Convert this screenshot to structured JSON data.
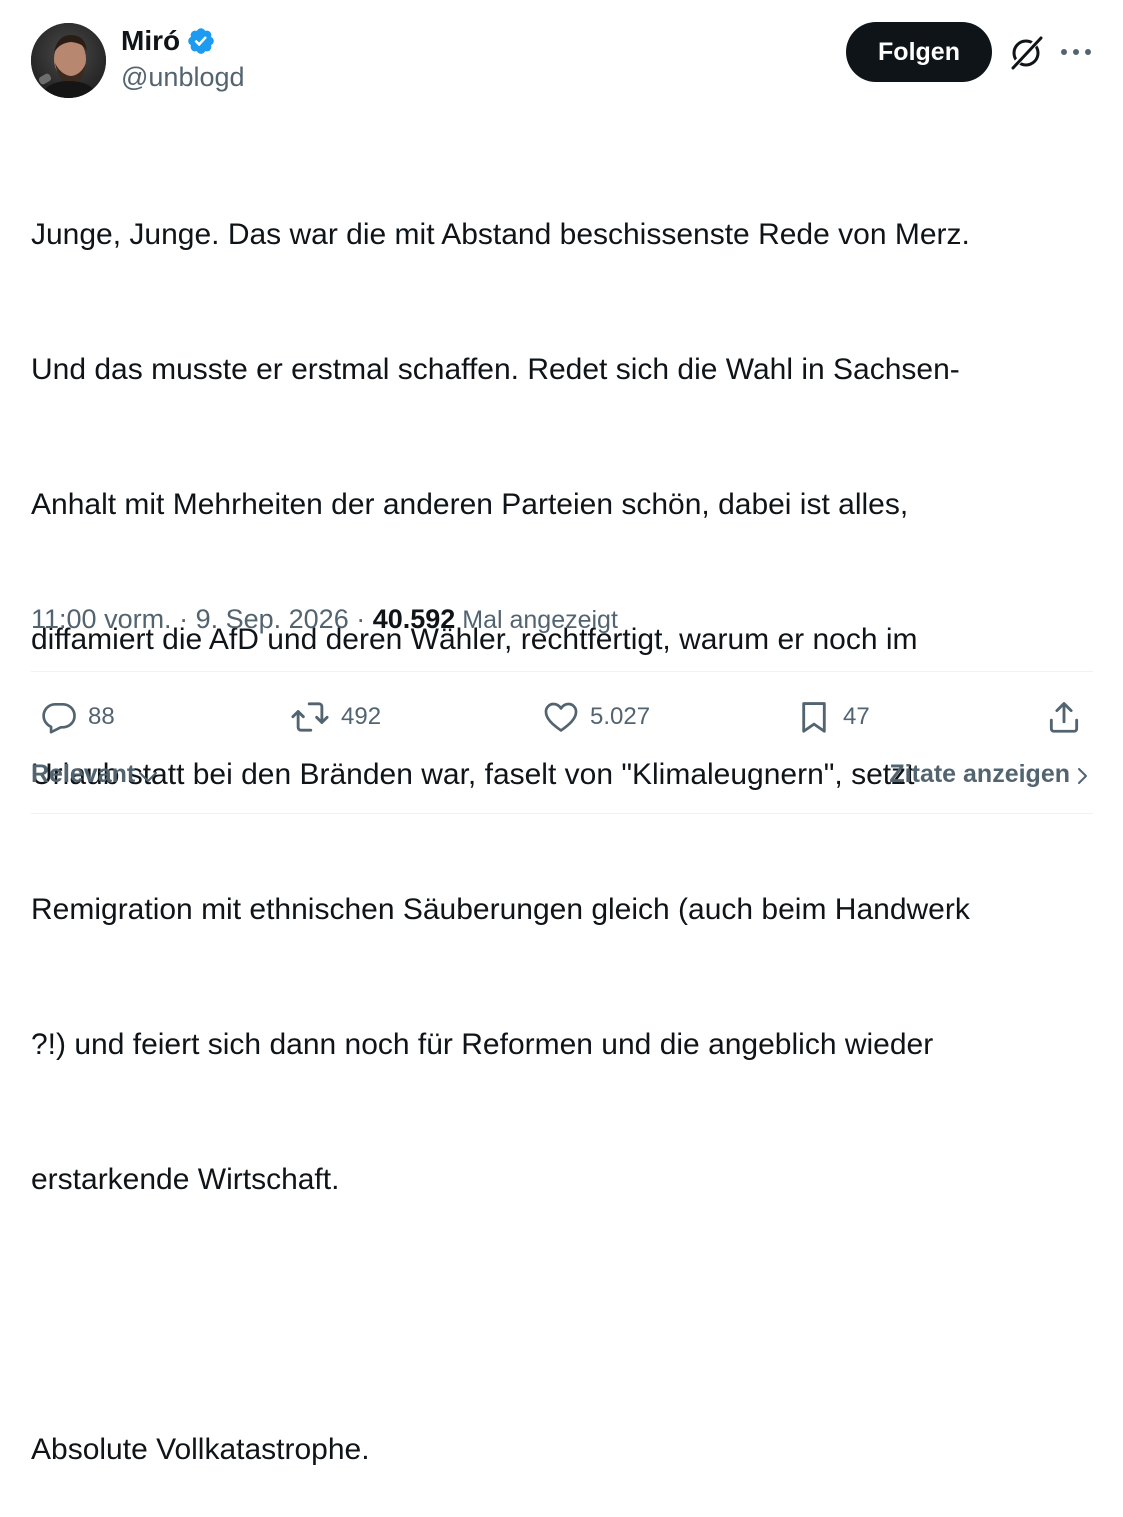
{
  "author": {
    "name": "Miró",
    "handle": "@unblogd",
    "verified": true
  },
  "header": {
    "follow_label": "Folgen"
  },
  "tweet": {
    "lines": [
      "Junge, Junge. Das war die mit Abstand beschissenste Rede von Merz.",
      "Und das musste er erstmal schaffen. Redet sich die Wahl in Sachsen-",
      "Anhalt mit Mehrheiten der anderen Parteien schön, dabei ist alles,",
      "diffamiert die AfD und deren Wähler, rechtfertigt, warum er noch im",
      "Urlaub statt bei den Bränden war, faselt von \"Klimaleugnern\", setzt",
      "Remigration mit ethnischen Säuberungen gleich (auch beim Handwerk",
      "?!) und feiert sich dann noch für Reformen und die angeblich wieder",
      "erstarkende Wirtschaft."
    ],
    "closing": "Absolute Vollkatastrophe."
  },
  "meta": {
    "time": "11:00 vorm.",
    "sep1": " · ",
    "date": "9. Sep. 2026",
    "sep2": " · ",
    "views": "40.592",
    "views_label": " Mal angezeigt"
  },
  "actions": {
    "replies": "88",
    "reposts": "492",
    "likes": "5.027",
    "bookmarks": "47"
  },
  "footer": {
    "sort_label": "Relevant",
    "quotes_label": "Zitate anzeigen"
  },
  "colors": {
    "verified_blue": "#1d9bf0",
    "text_primary": "#0f1419",
    "text_secondary": "#536471",
    "divider": "#eff3f4"
  }
}
